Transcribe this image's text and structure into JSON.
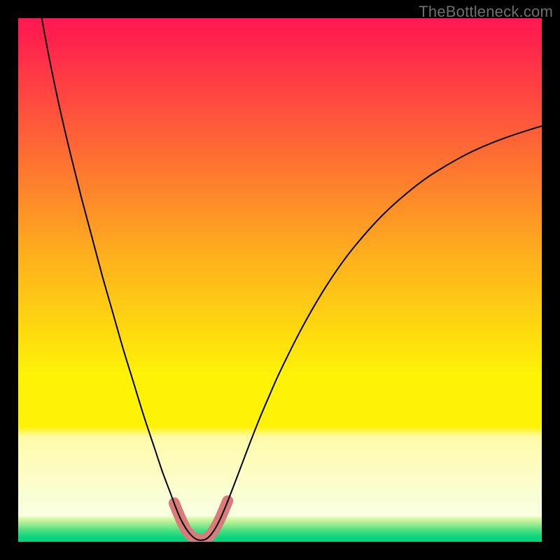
{
  "watermark": "TheBottleneck.com",
  "chart_data": {
    "type": "line",
    "title": "",
    "xlabel": "",
    "ylabel": "",
    "xlim": [
      0,
      100
    ],
    "ylim": [
      0,
      100
    ],
    "grid": false,
    "background_gradient": {
      "stops": [
        {
          "offset": 0.0,
          "color": "#ff1a53"
        },
        {
          "offset": 0.03,
          "color": "#ff1e4e"
        },
        {
          "offset": 0.45,
          "color": "#feae1e"
        },
        {
          "offset": 0.68,
          "color": "#fef207"
        },
        {
          "offset": 0.78,
          "color": "#fef207"
        },
        {
          "offset": 0.8,
          "color": "#fffbaa"
        },
        {
          "offset": 0.95,
          "color": "#f9ffe2"
        },
        {
          "offset": 0.955,
          "color": "#daf8a8"
        },
        {
          "offset": 0.965,
          "color": "#a4ed8f"
        },
        {
          "offset": 0.978,
          "color": "#4cdf84"
        },
        {
          "offset": 0.99,
          "color": "#10d57d"
        },
        {
          "offset": 1.0,
          "color": "#03d37d"
        }
      ]
    },
    "series": [
      {
        "name": "curve",
        "stroke": "#000000",
        "stroke_width": 2,
        "points": [
          {
            "x": 4.5,
            "y": 100.0
          },
          {
            "x": 6.0,
            "y": 92.0
          },
          {
            "x": 8.0,
            "y": 82.5
          },
          {
            "x": 10.0,
            "y": 74.0
          },
          {
            "x": 12.0,
            "y": 66.0
          },
          {
            "x": 14.0,
            "y": 58.5
          },
          {
            "x": 16.0,
            "y": 51.0
          },
          {
            "x": 18.0,
            "y": 44.0
          },
          {
            "x": 20.0,
            "y": 37.0
          },
          {
            "x": 22.0,
            "y": 30.5
          },
          {
            "x": 24.0,
            "y": 24.0
          },
          {
            "x": 26.0,
            "y": 18.0
          },
          {
            "x": 27.5,
            "y": 13.5
          },
          {
            "x": 29.0,
            "y": 9.5
          },
          {
            "x": 30.0,
            "y": 6.8
          },
          {
            "x": 31.0,
            "y": 4.4
          },
          {
            "x": 32.0,
            "y": 2.6
          },
          {
            "x": 33.0,
            "y": 1.3
          },
          {
            "x": 34.0,
            "y": 0.5
          },
          {
            "x": 35.0,
            "y": 0.3
          },
          {
            "x": 36.0,
            "y": 0.6
          },
          {
            "x": 37.0,
            "y": 1.6
          },
          {
            "x": 38.0,
            "y": 3.2
          },
          {
            "x": 39.0,
            "y": 5.3
          },
          {
            "x": 40.0,
            "y": 7.7
          },
          {
            "x": 42.0,
            "y": 12.9
          },
          {
            "x": 44.0,
            "y": 18.2
          },
          {
            "x": 46.0,
            "y": 23.3
          },
          {
            "x": 48.0,
            "y": 28.0
          },
          {
            "x": 50.0,
            "y": 32.5
          },
          {
            "x": 54.0,
            "y": 40.5
          },
          {
            "x": 58.0,
            "y": 47.5
          },
          {
            "x": 62.0,
            "y": 53.5
          },
          {
            "x": 66.0,
            "y": 58.5
          },
          {
            "x": 70.0,
            "y": 62.8
          },
          {
            "x": 74.0,
            "y": 66.4
          },
          {
            "x": 78.0,
            "y": 69.5
          },
          {
            "x": 82.0,
            "y": 72.0
          },
          {
            "x": 86.0,
            "y": 74.2
          },
          {
            "x": 90.0,
            "y": 76.0
          },
          {
            "x": 94.0,
            "y": 77.5
          },
          {
            "x": 98.0,
            "y": 78.8
          },
          {
            "x": 100.0,
            "y": 79.4
          }
        ]
      },
      {
        "name": "valley-highlight",
        "stroke": "#d97b7b",
        "stroke_width": 16,
        "points": [
          {
            "x": 29.8,
            "y": 7.4
          },
          {
            "x": 30.6,
            "y": 5.4
          },
          {
            "x": 31.4,
            "y": 3.6
          },
          {
            "x": 32.2,
            "y": 2.1
          },
          {
            "x": 33.0,
            "y": 1.2
          },
          {
            "x": 34.0,
            "y": 0.55
          },
          {
            "x": 35.0,
            "y": 0.35
          },
          {
            "x": 36.0,
            "y": 0.7
          },
          {
            "x": 36.8,
            "y": 1.4
          },
          {
            "x": 37.6,
            "y": 2.6
          },
          {
            "x": 38.4,
            "y": 4.1
          },
          {
            "x": 39.2,
            "y": 5.9
          },
          {
            "x": 40.0,
            "y": 7.8
          }
        ]
      }
    ]
  }
}
